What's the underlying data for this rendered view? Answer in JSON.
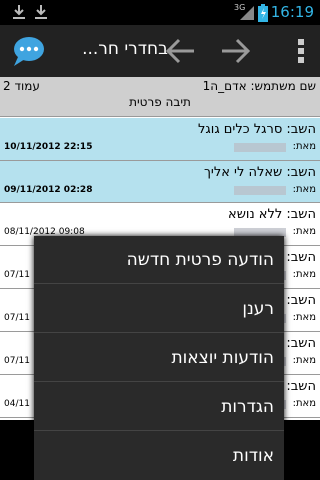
{
  "status_bar": {
    "time": "16:19",
    "network": "3G",
    "icons": [
      "download-icon",
      "download-icon",
      "signal-icon",
      "battery-icon"
    ]
  },
  "action_bar": {
    "title": "בחדרי חר...",
    "icons": [
      "chat-bubble-icon",
      "arrow-left-icon",
      "arrow-right-icon",
      "overflow-menu-icon"
    ]
  },
  "header": {
    "user_label": "שם משתמש: אדם_ה1",
    "page_label": "עמוד 2",
    "box_label": "תיבה פרטית"
  },
  "messages": [
    {
      "subject": "השב: סרגל כלים גוגל",
      "from_label": "מאת:",
      "date": "10/11/2012 22:15",
      "read": true
    },
    {
      "subject": "השב: שאלה לי אליך",
      "from_label": "מאת:",
      "date": "09/11/2012 02:28",
      "read": true
    },
    {
      "subject": "השב: ללא נושא",
      "from_label": "מאת:",
      "date": "08/11/2012 09:08",
      "read": false
    },
    {
      "subject": "השב:",
      "from_label": "מאת:",
      "date": "07/11",
      "read": false
    },
    {
      "subject": "השב:",
      "from_label": "מאת:",
      "date": "07/11",
      "read": false
    },
    {
      "subject": "השב:",
      "from_label": "מאת:",
      "date": "07/11",
      "read": false
    },
    {
      "subject": "השב:",
      "from_label": "מאת:",
      "date": "04/11",
      "read": false
    }
  ],
  "menu": {
    "items": [
      "הודעה פרטית חדשה",
      "רענן",
      "הודעות יוצאות",
      "הגדרות",
      "אודות"
    ]
  },
  "colors": {
    "read_bg": "#b5e1ee",
    "header_bg": "#cfcfcf",
    "menu_bg": "#2a2a2a",
    "clock": "#33b5e5"
  }
}
